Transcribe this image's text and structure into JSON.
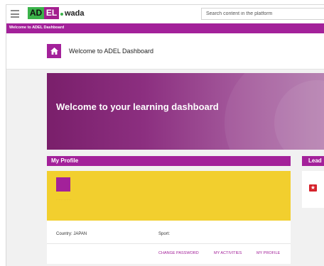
{
  "topbar": {
    "logo": {
      "part1": "AD",
      "part2": "EL",
      "partner": "wada",
      "partner_prefix": ""
    },
    "search": {
      "placeholder": "Search content in the platform",
      "value": ""
    }
  },
  "breadcrumb": {
    "label": "Welcome to ADEL Dashboard"
  },
  "page_header": {
    "title": "Welcome to ADEL Dashboard",
    "home_icon": "home-icon"
  },
  "hero": {
    "text": "Welcome to your learning dashboard"
  },
  "profile": {
    "section_title": "My Profile",
    "name_placeholder": "· · · · · · · · · · · ·",
    "country_label": "Country: JAPAN",
    "sport_label": "Sport:",
    "links": {
      "change_password": "CHANGE PASSWORD",
      "my_activities": "MY ACTIVITIES",
      "my_profile": "MY PROFILE"
    }
  },
  "leaderboard": {
    "section_title": "Lead",
    "icon": "star-badge-icon"
  },
  "colors": {
    "brand_purple": "#a3219a",
    "card_yellow": "#f2cf2e",
    "logo_green": "#3bb34a"
  }
}
